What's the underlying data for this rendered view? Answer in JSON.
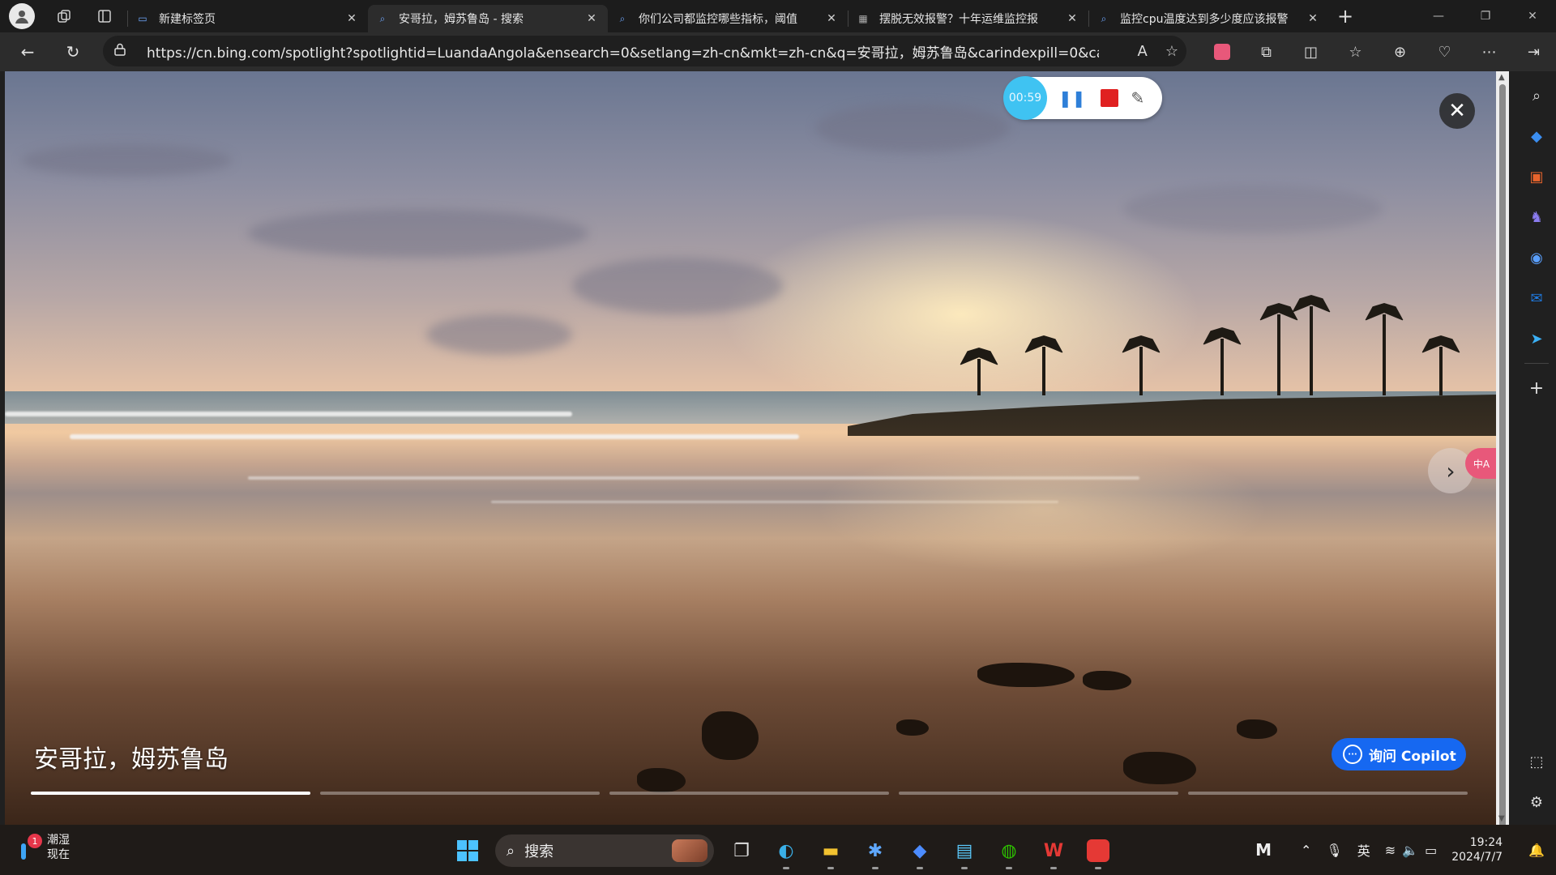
{
  "tabs": [
    {
      "title": "新建标签页",
      "active": false
    },
    {
      "title": "安哥拉，姆苏鲁岛 - 搜索",
      "active": true
    },
    {
      "title": "你们公司都监控哪些指标，阈值",
      "active": false
    },
    {
      "title": "摆脱无效报警？十年运维监控报",
      "active": false
    },
    {
      "title": "监控cpu温度达到多少度应该报警",
      "active": false
    }
  ],
  "address": {
    "url": "https://cn.bing.com/spotlight?spotlightid=LuandaAngola&ensearch=0&setlang=zh-cn&mkt=zh-cn&q=安哥拉，姆苏鲁岛&carindexpill=0&carindexi..."
  },
  "recorder": {
    "timer": "00:59"
  },
  "spotlight": {
    "caption": "安哥拉，姆苏鲁岛",
    "copilot_label": "询问 Copilot",
    "progress_total": 5,
    "progress_current": 1
  },
  "translate_badge": "中A",
  "taskbar": {
    "weather_title": "潮湿",
    "weather_sub": "现在",
    "weather_badge": "1",
    "search_placeholder": "搜索",
    "ime": "英",
    "time": "19:24",
    "date": "2024/7/7"
  },
  "colors": {
    "accent": "#1668f1",
    "recorder_timer": "#3fc3f2",
    "recorder_stop": "#e02020",
    "tab_bar": "#1c1c1c",
    "nav_bar": "#2c2c2c"
  }
}
